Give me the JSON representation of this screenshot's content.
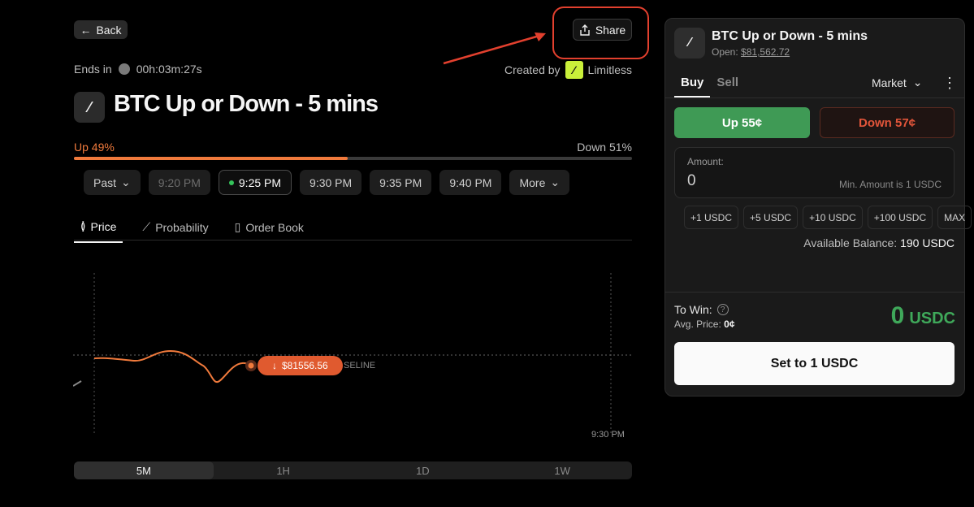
{
  "header": {
    "back_label": "Back",
    "share_label": "Share",
    "ends_label": "Ends in",
    "ends_value": "00h:03m:27s",
    "created_by_label": "Created by",
    "creator_name": "Limitless"
  },
  "market": {
    "title": "BTC Up or Down - 5 mins",
    "up_label": "Up 49%",
    "down_label": "Down 51%",
    "up_fraction": 0.49
  },
  "time_chips": {
    "past": "Past",
    "t1": "9:20 PM",
    "t2": "9:25 PM",
    "t3": "9:30 PM",
    "t4": "9:35 PM",
    "t5": "9:40 PM",
    "more": "More"
  },
  "tabs": {
    "price": "Price",
    "probability": "Probability",
    "order_book": "Order Book"
  },
  "chart": {
    "price_tag": "$81556.56",
    "baseline_label": "SELINE",
    "end_time_label": "9:30 PM"
  },
  "ranges": [
    "5M",
    "1H",
    "1D",
    "1W"
  ],
  "panel": {
    "title": "BTC Up or Down - 5 mins",
    "open_label": "Open:",
    "open_value": "$81,562.72",
    "buy_tab": "Buy",
    "sell_tab": "Sell",
    "order_type": "Market",
    "up_button": "Up 55¢",
    "down_button": "Down 57¢",
    "amount_label": "Amount:",
    "amount_value": "0",
    "min_amount": "Min. Amount is 1 USDC",
    "quick": [
      "+1 USDC",
      "+5 USDC",
      "+10 USDC",
      "+100 USDC",
      "MAX"
    ],
    "balance_label": "Available Balance:",
    "balance_value": "190 USDC",
    "to_win_label": "To Win:",
    "avg_price_label": "Avg. Price:",
    "avg_price_value": "0¢",
    "win_value": "0",
    "win_unit": "USDC",
    "set_button": "Set to 1 USDC"
  },
  "colors": {
    "accent_orange": "#f07a3c",
    "up_green": "#3f9a55",
    "down_red": "#e2553a",
    "highlight_red": "#e2402e"
  }
}
